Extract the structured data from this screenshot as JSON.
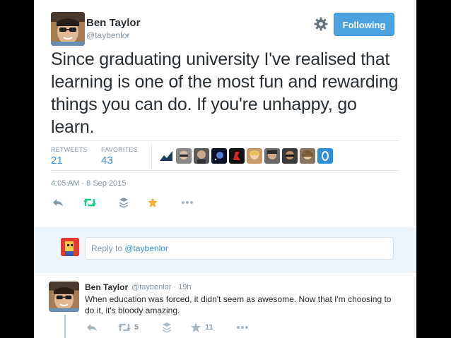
{
  "tweet": {
    "author_name": "Ben Taylor",
    "author_handle": "@taybenlor",
    "follow_label": "Following",
    "text": "Since graduating university I've realised that learning is one of the most fun and rewarding things you can do. If you're unhappy, go learn.",
    "retweets_label": "RETWEETS",
    "retweets_count": "21",
    "favorites_label": "FAVORITES",
    "favorites_count": "43",
    "timestamp": "4:05 AM - 8 Sep 2015"
  },
  "favoriters": [
    "favoriter-avatar-1",
    "favoriter-avatar-2",
    "favoriter-avatar-3",
    "favoriter-avatar-4",
    "favoriter-avatar-5",
    "favoriter-avatar-6",
    "favoriter-avatar-7",
    "favoriter-avatar-8",
    "favoriter-avatar-9",
    "favoriter-avatar-10"
  ],
  "actions": {
    "icons": [
      "reply-icon",
      "retweet-icon",
      "stack-icon",
      "star-icon",
      "more-icon"
    ]
  },
  "reply_box": {
    "prefix": "Reply to ",
    "mention": "@taybenlor"
  },
  "reply": {
    "author_name": "Ben Taylor",
    "meta": "@taybenlor · 19h",
    "text": "When education was forced, it didn't seem as awesome. Now that I'm choosing to do it, it's bloody amazing.",
    "retweet_count": "5",
    "favorite_count": "11"
  },
  "colors": {
    "accent": "#4aa3df",
    "retweet_green": "#19cf86",
    "favorite_gold": "#ffac33",
    "muted": "#8899a6",
    "text": "#292f33"
  }
}
